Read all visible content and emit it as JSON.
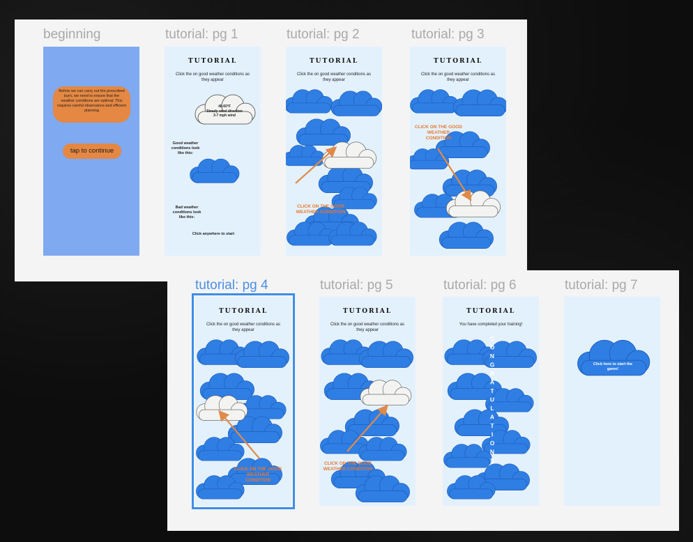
{
  "colors": {
    "canvas": "#0d0d0d",
    "board": "#f4f4f4",
    "frame_bg": "#e3f1fd",
    "cloud_blue": "#2f7ee4",
    "cloud_white": "#f3f3f1",
    "orange": "#e58843",
    "selected": "#3d8ee8"
  },
  "frames": {
    "beginning": {
      "label": "beginning",
      "message": "Before we can carry out the prescribed burn, we need to ensure that the weather conditions are optimal. This requires careful observance and efficient planning",
      "button": "tap to continue"
    },
    "pg1": {
      "label": "tutorial: pg 1",
      "title": "TUTORIAL",
      "instruction": "Click the on good weather conditions as they appear",
      "cloud_text": "48-60°F\nSteady wind direction\n3-7 mph wind",
      "good_text": "Good weather conditions look like this:",
      "bad_text": "Bad weather conditions look like this:",
      "start_text": "Click anywhere to start"
    },
    "pg2": {
      "label": "tutorial: pg 2",
      "title": "TUTORIAL",
      "instruction": "Click the on good weather conditions as they appear",
      "callout": "CLICK ON THE GOOD WEATHER CONDITION"
    },
    "pg3": {
      "label": "tutorial: pg 3",
      "title": "TUTORIAL",
      "instruction": "Click the on good weather conditions as they appear",
      "callout": "CLICK ON THE GOOD WEATHER CONDITION"
    },
    "pg4": {
      "label": "tutorial: pg 4",
      "title": "TUTORIAL",
      "instruction": "Click the on good weather conditions as they appear",
      "callout": "CLICK ON THE GOOD WEATHER CONDITION"
    },
    "pg5": {
      "label": "tutorial: pg 5",
      "title": "TUTORIAL",
      "instruction": "Click the on good weather conditions as they appear",
      "callout": "CLICK ON THE GOOD WEATHER CONDITION"
    },
    "pg6": {
      "label": "tutorial: pg 6",
      "title": "TUTORIAL",
      "instruction": "You have completed your training!",
      "banner": "CONGRATULATIONS"
    },
    "pg7": {
      "label": "tutorial: pg 7",
      "cloud_text": "Click here to start the game!"
    }
  }
}
